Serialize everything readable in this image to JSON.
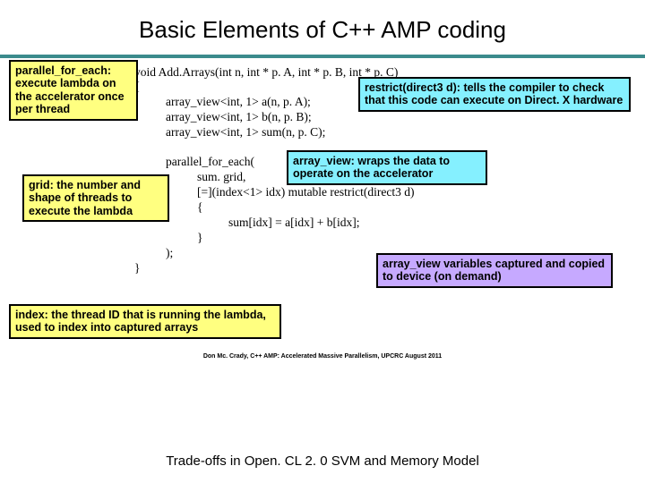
{
  "title": "Basic Elements of C++ AMP coding",
  "code": {
    "sig": "void Add.Arrays(int n, int * p. A, int * p. B, int * p. C)",
    "brace_open": "{",
    "aview_a": "array_view<int, 1> a(n, p. A);",
    "aview_b": "array_view<int, 1> b(n, p. B);",
    "aview_sum": "array_view<int, 1> sum(n, p. C);",
    "pfe": "parallel_for_each(",
    "grid": "sum. grid,",
    "lambda_sig": "[=](index<1> idx) mutable restrict(direct3 d)",
    "lambda_open": "{",
    "body": "sum[idx] = a[idx] + b[idx];",
    "lambda_close": "}",
    "paren_close": ");",
    "brace_close": "}"
  },
  "callouts": {
    "pfe": "parallel_for_each:\nexecute lambda on\nthe accelerator\nonce per thread",
    "grid": "grid: the number and\nshape of threads to\nexecute the lambda",
    "index": "index: the thread ID that is running the\nlambda, used to index into captured arrays",
    "restrict": "restrict(direct3 d): tells the compiler\nto check that this code can execute\non Direct. X hardware",
    "array_view": "array_view: wraps the data to\noperate on the accelerator",
    "capture": "array_view variables captured and\ncopied to device (on demand)"
  },
  "citation": "Don Mc. Crady, C++ AMP: Accelerated Massive Parallelism, UPCRC August 2011",
  "footer": "Trade-offs in Open. CL 2. 0 SVM and Memory Model"
}
